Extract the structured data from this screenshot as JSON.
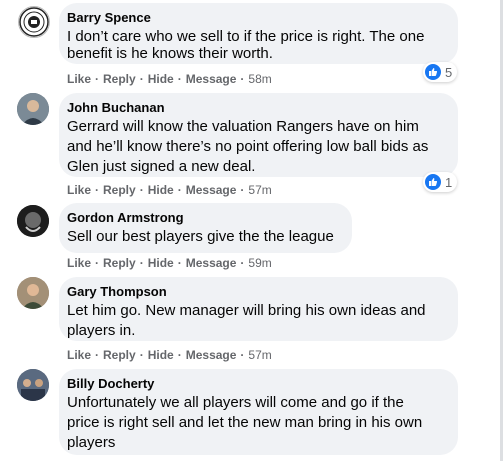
{
  "actions": {
    "like": "Like",
    "reply": "Reply",
    "hide": "Hide",
    "message": "Message",
    "sep": "·"
  },
  "comments": [
    {
      "author": "Barry Spence",
      "lines": [
        "I don’t care who we sell to if the price is right. The one",
        "benefit is he knows their worth."
      ],
      "time": "58m",
      "reactions": "5",
      "avatar": "badge-logo"
    },
    {
      "author": "John Buchanan",
      "lines": [
        "Gerrard will know the valuation Rangers have on him",
        "and he’ll know there’s no point offering low ball bids as",
        "Glen just signed a new deal."
      ],
      "time": "57m",
      "reactions": "1",
      "avatar": "person-photo"
    },
    {
      "author": "Gordon Armstrong",
      "lines": [
        "Sell our best players give the the league"
      ],
      "time": "59m",
      "avatar": "dark-photo"
    },
    {
      "author": "Gary Thompson",
      "lines": [
        "Let him go. New manager will bring his own ideas and",
        "players in."
      ],
      "time": "57m",
      "avatar": "person-photo"
    },
    {
      "author": "Billy Docherty",
      "lines": [
        "Unfortunately we all players will come and go if the",
        "price is right sell and let the new man bring in his own",
        "players"
      ],
      "avatar": "group-photo"
    }
  ],
  "colors": {
    "like_blue": "#1877f2",
    "bubble": "#f0f2f5",
    "meta": "#65676b"
  }
}
